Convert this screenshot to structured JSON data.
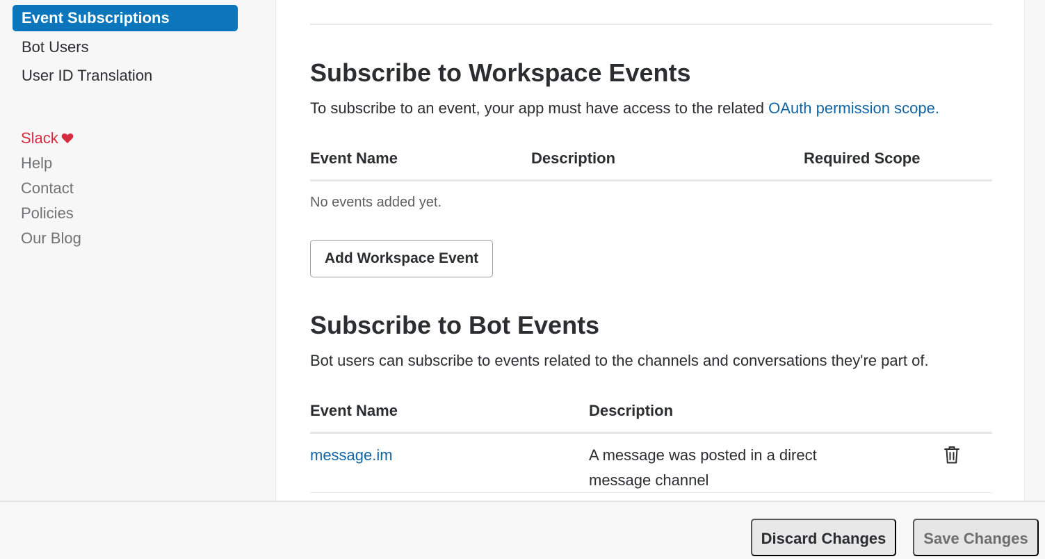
{
  "sidebar": {
    "nav": [
      {
        "label": "Event Subscriptions",
        "active": true
      },
      {
        "label": "Bot Users",
        "active": false
      },
      {
        "label": "User ID Translation",
        "active": false
      }
    ],
    "footer_links": {
      "slack": "Slack",
      "help": "Help",
      "contact": "Contact",
      "policies": "Policies",
      "blog": "Our Blog"
    },
    "heart_icon": "heart-icon",
    "accent_color": "#0b76bb",
    "slack_color": "#d72b3f"
  },
  "workspace_events": {
    "title": "Subscribe to Workspace Events",
    "description": "To subscribe to an event, your app must have access to the related ",
    "link_text": "OAuth permission scope.",
    "columns": [
      "Event Name",
      "Description",
      "Required Scope"
    ],
    "empty_text": "No events added yet.",
    "add_button": "Add Workspace Event"
  },
  "bot_events": {
    "title": "Subscribe to Bot Events",
    "description": "Bot users can subscribe to events related to the channels and conversations they're part of.",
    "columns": [
      "Event Name",
      "Description"
    ],
    "rows": [
      {
        "event_name": "message.im",
        "description": "A message was posted in a direct message channel",
        "action_icon": "trash-icon"
      }
    ]
  },
  "footer": {
    "discard_label": "Discard Changes",
    "save_label": "Save Changes"
  },
  "link_color": "#1264a3"
}
